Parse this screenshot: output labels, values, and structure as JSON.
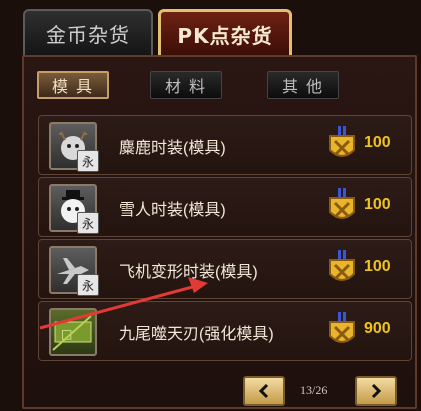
{
  "tabs": {
    "gold": "金币杂货",
    "pk": "PK点杂货"
  },
  "subtabs": {
    "mold": "模具",
    "material": "材料",
    "other": "其他"
  },
  "items": [
    {
      "name": "麋鹿时装(模具)",
      "badge": "永",
      "price": "100"
    },
    {
      "name": "雪人时装(模具)",
      "badge": "永",
      "price": "100"
    },
    {
      "name": "飞机变形时装(模具)",
      "badge": "永",
      "price": "100"
    },
    {
      "name": "九尾噬天刃(强化模具)",
      "badge": "",
      "price": "900"
    }
  ],
  "pagination": {
    "indicator": "13/26"
  },
  "colors": {
    "price_text": "#f0c21d",
    "arrow": "#e23a35",
    "active_tab_border": "#e3c071"
  },
  "icons": {
    "prev": "chevron-left-icon",
    "next": "chevron-right-icon",
    "price": "pk-medal-icon"
  }
}
